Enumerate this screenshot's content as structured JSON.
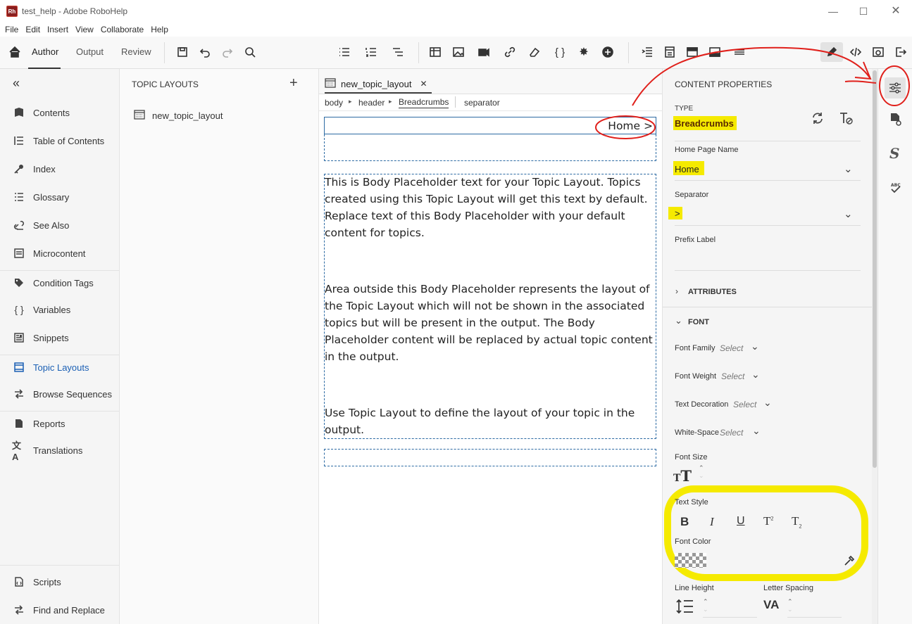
{
  "window": {
    "title": "test_help - Adobe RoboHelp",
    "logo": "Rh"
  },
  "menu": [
    "File",
    "Edit",
    "Insert",
    "View",
    "Collaborate",
    "Help"
  ],
  "toolbar": {
    "tabs": [
      "Author",
      "Output",
      "Review"
    ],
    "active_tab": "Author"
  },
  "left_nav": {
    "collapse_icon": "«",
    "items": [
      {
        "label": "Contents",
        "icon": "contents-icon"
      },
      {
        "label": "Table of Contents",
        "icon": "toc-icon"
      },
      {
        "label": "Index",
        "icon": "key-icon"
      },
      {
        "label": "Glossary",
        "icon": "glossary-icon"
      },
      {
        "label": "See Also",
        "icon": "see-also-icon"
      },
      {
        "label": "Microcontent",
        "icon": "microcontent-icon"
      },
      {
        "label": "Condition Tags",
        "icon": "tag-icon"
      },
      {
        "label": "Variables",
        "icon": "braces-icon"
      },
      {
        "label": "Snippets",
        "icon": "snippet-icon"
      },
      {
        "label": "Topic Layouts",
        "icon": "layout-icon"
      },
      {
        "label": "Browse Sequences",
        "icon": "sequence-icon"
      },
      {
        "label": "Reports",
        "icon": "report-icon"
      },
      {
        "label": "Translations",
        "icon": "translate-icon"
      },
      {
        "label": "Scripts",
        "icon": "script-icon"
      },
      {
        "label": "Find and Replace",
        "icon": "find-replace-icon"
      }
    ],
    "active": "Topic Layouts"
  },
  "layouts_panel": {
    "header": "TOPIC LAYOUTS",
    "add": "+",
    "items": [
      "new_topic_layout"
    ]
  },
  "editor": {
    "tab": "new_topic_layout",
    "close": "✕",
    "crumbs": [
      "body",
      "header",
      "Breadcrumbs",
      "separator"
    ],
    "crumb_sep": "▸",
    "breadcrumb_preview": "Home >",
    "body_paragraphs": [
      "This is Body Placeholder text for your Topic Layout. Topics created using this Topic Layout will get this text by default. Replace text of this Body Placeholder with your default content for topics.",
      "Area outside this Body Placeholder represents the layout of the Topic Layout which will not be shown in the associated topics but will be present in the output. The Body Placeholder content will be replaced by actual topic content in the output.",
      "Use Topic Layout to define the layout of your topic in the output."
    ]
  },
  "properties": {
    "header": "CONTENT PROPERTIES",
    "type_label": "TYPE",
    "type_value": "Breadcrumbs",
    "home_label": "Home Page Name",
    "home_value": "Home",
    "separator_label": "Separator",
    "separator_value": ">",
    "prefix_label": "Prefix Label",
    "attributes": "ATTRIBUTES",
    "font": "FONT",
    "font_family": "Font Family",
    "font_weight": "Font Weight",
    "text_decoration": "Text Decoration",
    "white_space": "White-Space",
    "select": "Select",
    "font_size": "Font Size",
    "text_style": "Text Style",
    "style_buttons": [
      "B",
      "I",
      "U"
    ],
    "font_color": "Font Color",
    "line_height": "Line Height",
    "letter_spacing": "Letter Spacing",
    "highlight_color": "#f5ea00",
    "annotation_color": "#e0201b"
  }
}
